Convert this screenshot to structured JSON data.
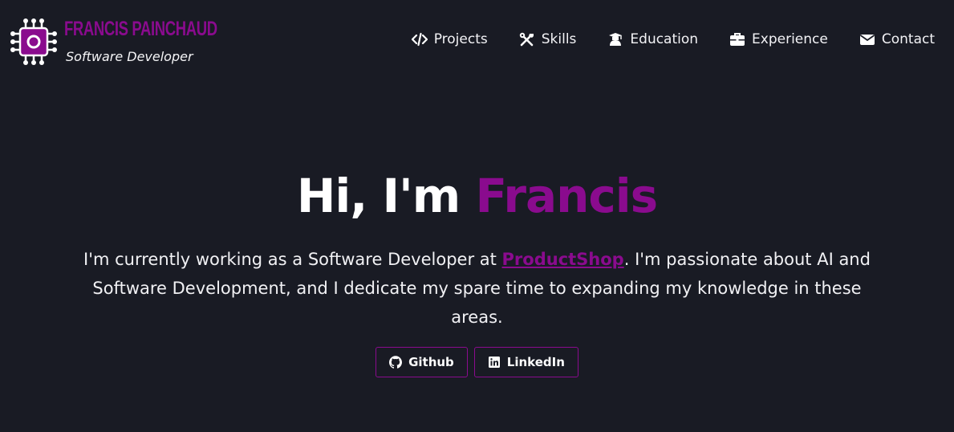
{
  "header": {
    "brand_name": "FRANCIS PAINCHAUD",
    "brand_role": "Software Developer",
    "logo_icon": "circuit-chip-icon"
  },
  "nav": {
    "items": [
      {
        "label": "Projects",
        "icon": "code-icon"
      },
      {
        "label": "Skills",
        "icon": "tools-icon"
      },
      {
        "label": "Education",
        "icon": "graduate-icon"
      },
      {
        "label": "Experience",
        "icon": "briefcase-icon"
      },
      {
        "label": "Contact",
        "icon": "envelope-icon"
      }
    ]
  },
  "hero": {
    "title_prefix": "Hi, I'm ",
    "title_name": "Francis",
    "text_before_link": "I'm currently working as a Software Developer at ",
    "link_text": "ProductShop",
    "text_after_link": ". I'm passionate about AI and Software Development, and I dedicate my spare time to expanding my knowledge in these areas."
  },
  "buttons": [
    {
      "label": "Github",
      "icon": "github-icon"
    },
    {
      "label": "LinkedIn",
      "icon": "linkedin-icon"
    }
  ],
  "colors": {
    "background": "#191b24",
    "accent": "#8a0b8e",
    "text": "#f1f1f4"
  }
}
